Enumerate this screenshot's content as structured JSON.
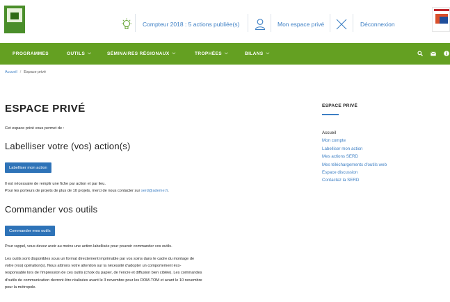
{
  "header": {
    "counter": "Compteur 2018 : 5 actions publiée(s)",
    "private_space": "Mon espace privé",
    "logout": "Déconnexion",
    "icons": [
      "lightbulb-icon",
      "user-icon",
      "close-icon"
    ]
  },
  "nav": {
    "items": [
      {
        "label": "PROGRAMMES",
        "dropdown": false
      },
      {
        "label": "OUTILS",
        "dropdown": true
      },
      {
        "label": "SÉMINAIRES RÉGIONAUX",
        "dropdown": true
      },
      {
        "label": "TROPHÉES",
        "dropdown": true
      },
      {
        "label": "BILANS",
        "dropdown": true
      }
    ],
    "right_icons": [
      "search-icon",
      "mail-icon",
      "info-icon"
    ],
    "color": "#64a022"
  },
  "breadcrumb": {
    "home": "Accueil",
    "separator": "/",
    "current": "Espace privé"
  },
  "main": {
    "title": "ESPACE PRIVÉ",
    "intro": "Cet espace privé vous permet de :",
    "section1_title": "Labelliser votre (vos) action(s)",
    "section1_button": "Labelliser mon action",
    "section1_note1": "Il est nécessaire de remplir une fiche par action et par lieu.",
    "section1_note2_pre": "Pour les porteurs de projets de plus de 10 projets, merci de nous contacter sur ",
    "section1_note2_link": "serd@ademe.fr",
    "section1_note2_post": ".",
    "section2_title": "Commander vos outils",
    "section2_button": "Commander mes outils",
    "section2_note": "Pour rappel, vous devez avoir au moins une action labellisée pour pouvoir commander vos outils.",
    "paragraph_lines": [
      "Les outils sont disponibles sous un format directement imprimable par vos soins dans le cadre du montage de",
      "votre (vos) opération(s). Nous attirons votre attention sur la nécessité d'adopter un comportement éco-",
      "responsable lors de l'impression de ces outils (choix du papier, de l'encre et diffusion bien ciblée). Les commandes",
      "d'outils de communication devront être réalisées avant le 3 novembre pour les DOM-TOM et avant le 10 novembre",
      "pour la métropole."
    ],
    "button_color": "#2e73b8"
  },
  "sidebar": {
    "title": "ESPACE PRIVÉ",
    "items": [
      {
        "label": "Accueil",
        "current": true
      },
      {
        "label": "Mon compte",
        "current": false
      },
      {
        "label": "Labelliser mon action",
        "current": false
      },
      {
        "label": "Mes actions SERD",
        "current": false
      },
      {
        "label": "Mes téléchargements d'outils web",
        "current": false
      },
      {
        "label": "Espace discussion",
        "current": false
      },
      {
        "label": "Contactez la SERD",
        "current": false
      }
    ],
    "link_color": "#3d7fc4"
  }
}
